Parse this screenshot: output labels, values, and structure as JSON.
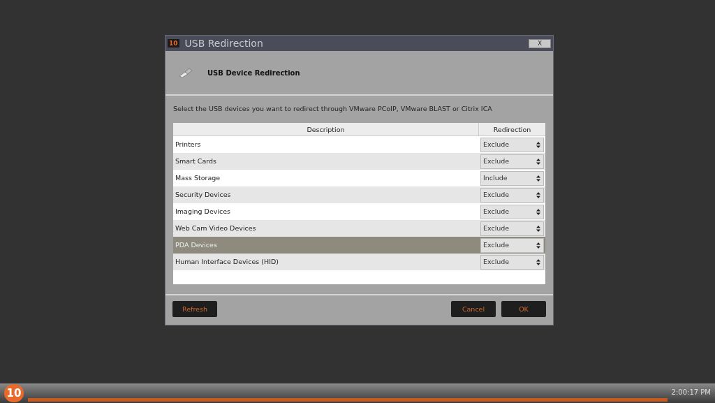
{
  "window": {
    "logo": "10",
    "title": "USB Redirection",
    "close": "X"
  },
  "header": {
    "title": "USB Device Redirection"
  },
  "instructions": "Select the USB devices you want to redirect through VMware PCoIP, VMware BLAST or Citrix ICA",
  "table": {
    "columns": [
      "Description",
      "Redirection"
    ],
    "rows": [
      {
        "description": "Printers",
        "redirection": "Exclude",
        "selected": false
      },
      {
        "description": "Smart Cards",
        "redirection": "Exclude",
        "selected": false
      },
      {
        "description": "Mass Storage",
        "redirection": "Include",
        "selected": false
      },
      {
        "description": "Security Devices",
        "redirection": "Exclude",
        "selected": false
      },
      {
        "description": "Imaging Devices",
        "redirection": "Exclude",
        "selected": false
      },
      {
        "description": "Web Cam Video Devices",
        "redirection": "Exclude",
        "selected": false
      },
      {
        "description": "PDA Devices",
        "redirection": "Exclude",
        "selected": true
      },
      {
        "description": "Human Interface Devices (HID)",
        "redirection": "Exclude",
        "selected": false
      }
    ]
  },
  "buttons": {
    "refresh": "Refresh",
    "cancel": "Cancel",
    "ok": "OK"
  },
  "taskbar": {
    "logo": "10",
    "clock": "2:00:17 PM"
  }
}
